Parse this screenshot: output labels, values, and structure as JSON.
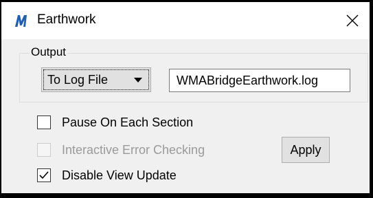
{
  "window": {
    "title": "Earthwork",
    "icon": "microstation-m-icon",
    "close_icon": "close-icon"
  },
  "output_group": {
    "label": "Output",
    "destination": {
      "selected": "To Log File"
    },
    "filename": {
      "value": "WMABridgeEarthwork.log"
    }
  },
  "options": [
    {
      "label": "Pause On Each Section",
      "checked": false,
      "enabled": true
    },
    {
      "label": "Interactive Error Checking",
      "checked": false,
      "enabled": false
    },
    {
      "label": "Disable View Update",
      "checked": true,
      "enabled": true
    }
  ],
  "apply_label": "Apply",
  "colors": {
    "icon_blue": "#1f5fb8",
    "window_bg": "#f0f0f0",
    "disabled_text": "#9a9a9a"
  }
}
